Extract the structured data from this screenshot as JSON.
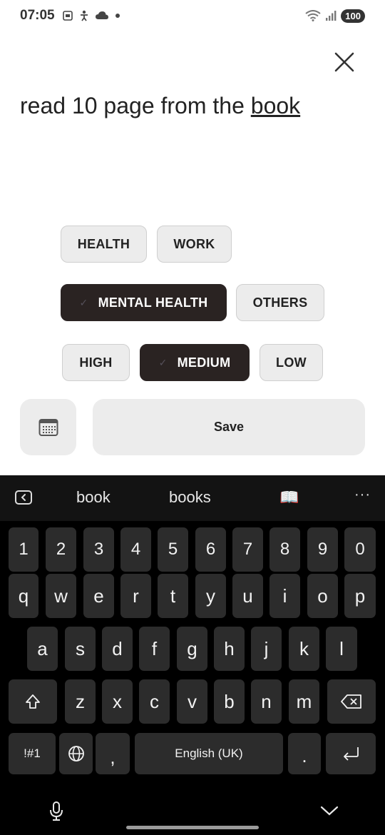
{
  "status_bar": {
    "time": "07:05",
    "battery": "100",
    "icons": [
      "screenshot-icon",
      "accessibility-icon",
      "cloud-icon",
      "dot-icon",
      "wifi-icon",
      "signal-icon"
    ]
  },
  "task": {
    "title_prefix": "read 10 page from the ",
    "title_underlined": "book"
  },
  "categories": [
    {
      "label": "HEALTH",
      "selected": false
    },
    {
      "label": "WORK",
      "selected": false
    },
    {
      "label": "MENTAL HEALTH",
      "selected": true
    },
    {
      "label": "OTHERS",
      "selected": false
    }
  ],
  "priorities": [
    {
      "label": "HIGH",
      "selected": false
    },
    {
      "label": "MEDIUM",
      "selected": true
    },
    {
      "label": "LOW",
      "selected": false
    }
  ],
  "actions": {
    "calendar_icon": "calendar-icon",
    "save_label": "Save"
  },
  "keyboard": {
    "suggestions": [
      "book",
      "books"
    ],
    "suggestion_emoji": "📖",
    "more": "···",
    "number_row": [
      "1",
      "2",
      "3",
      "4",
      "5",
      "6",
      "7",
      "8",
      "9",
      "0"
    ],
    "row1": [
      "q",
      "w",
      "e",
      "r",
      "t",
      "y",
      "u",
      "i",
      "o",
      "p"
    ],
    "row2": [
      "a",
      "s",
      "d",
      "f",
      "g",
      "h",
      "j",
      "k",
      "l"
    ],
    "row3": [
      "z",
      "x",
      "c",
      "v",
      "b",
      "n",
      "m"
    ],
    "symbols_label": "!#1",
    "comma": ",",
    "space_label": "English (UK)",
    "period": "."
  }
}
